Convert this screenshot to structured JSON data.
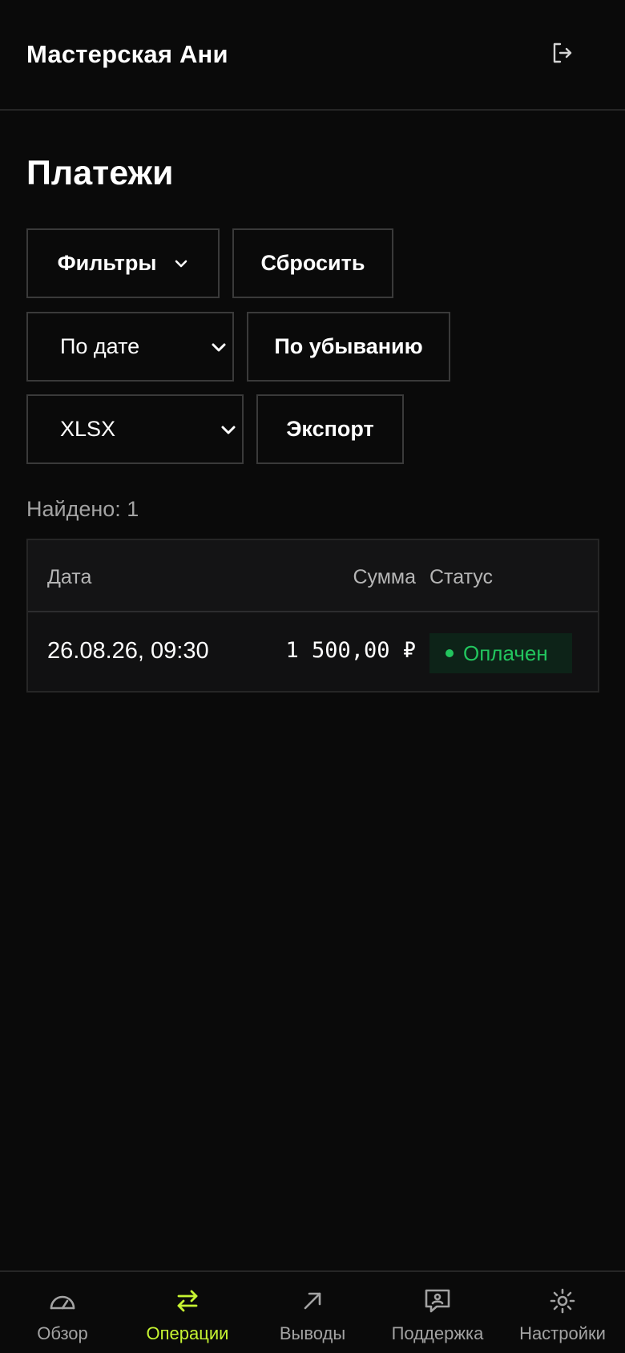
{
  "header": {
    "shop_name": "Мастерская Ани",
    "logout_icon": "logout-icon"
  },
  "page": {
    "title": "Платежи"
  },
  "controls": {
    "filters_label": "Фильтры",
    "reset_label": "Сбросить",
    "sort_by_selected": "По дате",
    "sort_order_label": "По убыванию",
    "export_format_selected": "XLSX",
    "export_label": "Экспорт"
  },
  "results": {
    "found_text": "Найдено: 1"
  },
  "table": {
    "columns": [
      "Дата",
      "Сумма",
      "Статус"
    ],
    "rows": [
      {
        "date": "26.08.26, 09:30",
        "amount": "1 500,00 ₽",
        "status": "Оплачен"
      }
    ]
  },
  "bottom_nav": {
    "items": [
      {
        "label": "Обзор",
        "icon": "gauge-icon",
        "active": false
      },
      {
        "label": "Операции",
        "icon": "arrows-swap-icon",
        "active": true
      },
      {
        "label": "Выводы",
        "icon": "arrow-up-right-icon",
        "active": false
      },
      {
        "label": "Поддержка",
        "icon": "support-chat-icon",
        "active": false
      },
      {
        "label": "Настройки",
        "icon": "gear-icon",
        "active": false
      }
    ]
  },
  "colors": {
    "background": "#0a0a0a",
    "accent": "#c6f432",
    "status_paid": "#22c55e",
    "status_paid_bg": "#0d2318",
    "border": "#3a3a3a"
  }
}
